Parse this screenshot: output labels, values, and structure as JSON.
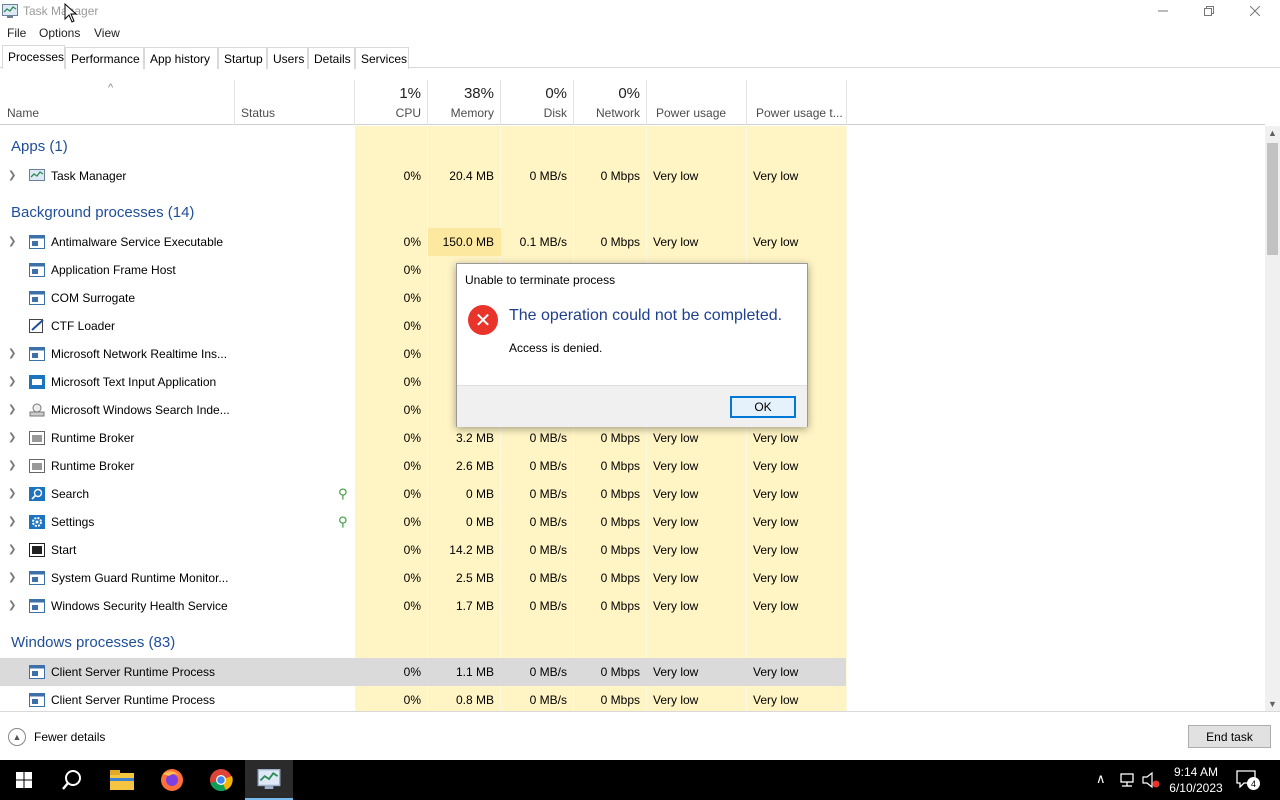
{
  "window": {
    "title": "Task Manager"
  },
  "menu": [
    "File",
    "Options",
    "View"
  ],
  "tabs": [
    "Processes",
    "Performance",
    "App history",
    "Startup",
    "Users",
    "Details",
    "Services"
  ],
  "columns": {
    "name": "Name",
    "status": "Status",
    "cpu_pct": "1%",
    "cpu": "CPU",
    "memory_pct": "38%",
    "memory": "Memory",
    "disk_pct": "0%",
    "disk": "Disk",
    "network_pct": "0%",
    "network": "Network",
    "power": "Power usage",
    "power_trend": "Power usage t..."
  },
  "groups": {
    "apps": "Apps (1)",
    "background": "Background processes (14)",
    "windows": "Windows processes (83)"
  },
  "processes": [
    {
      "name": "Task Manager",
      "cpu": "0%",
      "memory": "20.4 MB",
      "disk": "0 MB/s",
      "network": "0 Mbps",
      "power": "Very low",
      "power_trend": "Very low",
      "icon": "task-manager-icon"
    },
    {
      "name": "Antimalware Service Executable",
      "cpu": "0%",
      "memory": "150.0 MB",
      "disk": "0.1 MB/s",
      "network": "0 Mbps",
      "power": "Very low",
      "power_trend": "Very low",
      "icon": "service-icon"
    },
    {
      "name": "Application Frame Host",
      "cpu": "0%",
      "icon": "service-icon"
    },
    {
      "name": "COM Surrogate",
      "cpu": "0%",
      "icon": "service-icon"
    },
    {
      "name": "CTF Loader",
      "cpu": "0%",
      "icon": "ctf-icon"
    },
    {
      "name": "Microsoft Network Realtime Ins...",
      "cpu": "0%",
      "icon": "service-icon"
    },
    {
      "name": "Microsoft Text Input Application",
      "cpu": "0%",
      "icon": "keyboard-icon"
    },
    {
      "name": "Microsoft Windows Search Inde...",
      "cpu": "0%",
      "icon": "search-indexer-icon"
    },
    {
      "name": "Runtime Broker",
      "cpu": "0%",
      "memory": "3.2 MB",
      "disk": "0 MB/s",
      "network": "0 Mbps",
      "power": "Very low",
      "power_trend": "Very low",
      "icon": "service-icon"
    },
    {
      "name": "Runtime Broker",
      "cpu": "0%",
      "memory": "2.6 MB",
      "disk": "0 MB/s",
      "network": "0 Mbps",
      "power": "Very low",
      "power_trend": "Very low",
      "icon": "service-icon"
    },
    {
      "name": "Search",
      "cpu": "0%",
      "memory": "0 MB",
      "disk": "0 MB/s",
      "network": "0 Mbps",
      "power": "Very low",
      "power_trend": "Very low",
      "icon": "search-icon"
    },
    {
      "name": "Settings",
      "cpu": "0%",
      "memory": "0 MB",
      "disk": "0 MB/s",
      "network": "0 Mbps",
      "power": "Very low",
      "power_trend": "Very low",
      "icon": "gear-icon"
    },
    {
      "name": "Start",
      "cpu": "0%",
      "memory": "14.2 MB",
      "disk": "0 MB/s",
      "network": "0 Mbps",
      "power": "Very low",
      "power_trend": "Very low",
      "icon": "start-icon"
    },
    {
      "name": "System Guard Runtime Monitor...",
      "cpu": "0%",
      "memory": "2.5 MB",
      "disk": "0 MB/s",
      "network": "0 Mbps",
      "power": "Very low",
      "power_trend": "Very low",
      "icon": "service-icon"
    },
    {
      "name": "Windows Security Health Service",
      "cpu": "0%",
      "memory": "1.7 MB",
      "disk": "0 MB/s",
      "network": "0 Mbps",
      "power": "Very low",
      "power_trend": "Very low",
      "icon": "service-icon"
    },
    {
      "name": "Client Server Runtime Process",
      "cpu": "0%",
      "memory": "1.1 MB",
      "disk": "0 MB/s",
      "network": "0 Mbps",
      "power": "Very low",
      "power_trend": "Very low",
      "icon": "service-icon"
    },
    {
      "name": "Client Server Runtime Process",
      "cpu": "0%",
      "memory": "0.8 MB",
      "disk": "0 MB/s",
      "network": "0 Mbps",
      "power": "Very low",
      "power_trend": "Very low",
      "icon": "service-icon"
    }
  ],
  "dialog": {
    "title": "Unable to terminate process",
    "message": "The operation could not be completed.",
    "detail": "Access is denied.",
    "ok": "OK"
  },
  "footer": {
    "fewer_details": "Fewer details",
    "end_task": "End task"
  },
  "taskbar": {
    "time": "9:14 AM",
    "date": "6/10/2023",
    "notifications": "4"
  },
  "colors": {
    "accent": "#0078d7",
    "group_text": "#1f4e9a",
    "heat_light": "#fff4c4",
    "heat_medium": "#fde8a0",
    "error_red": "#e8342a"
  }
}
